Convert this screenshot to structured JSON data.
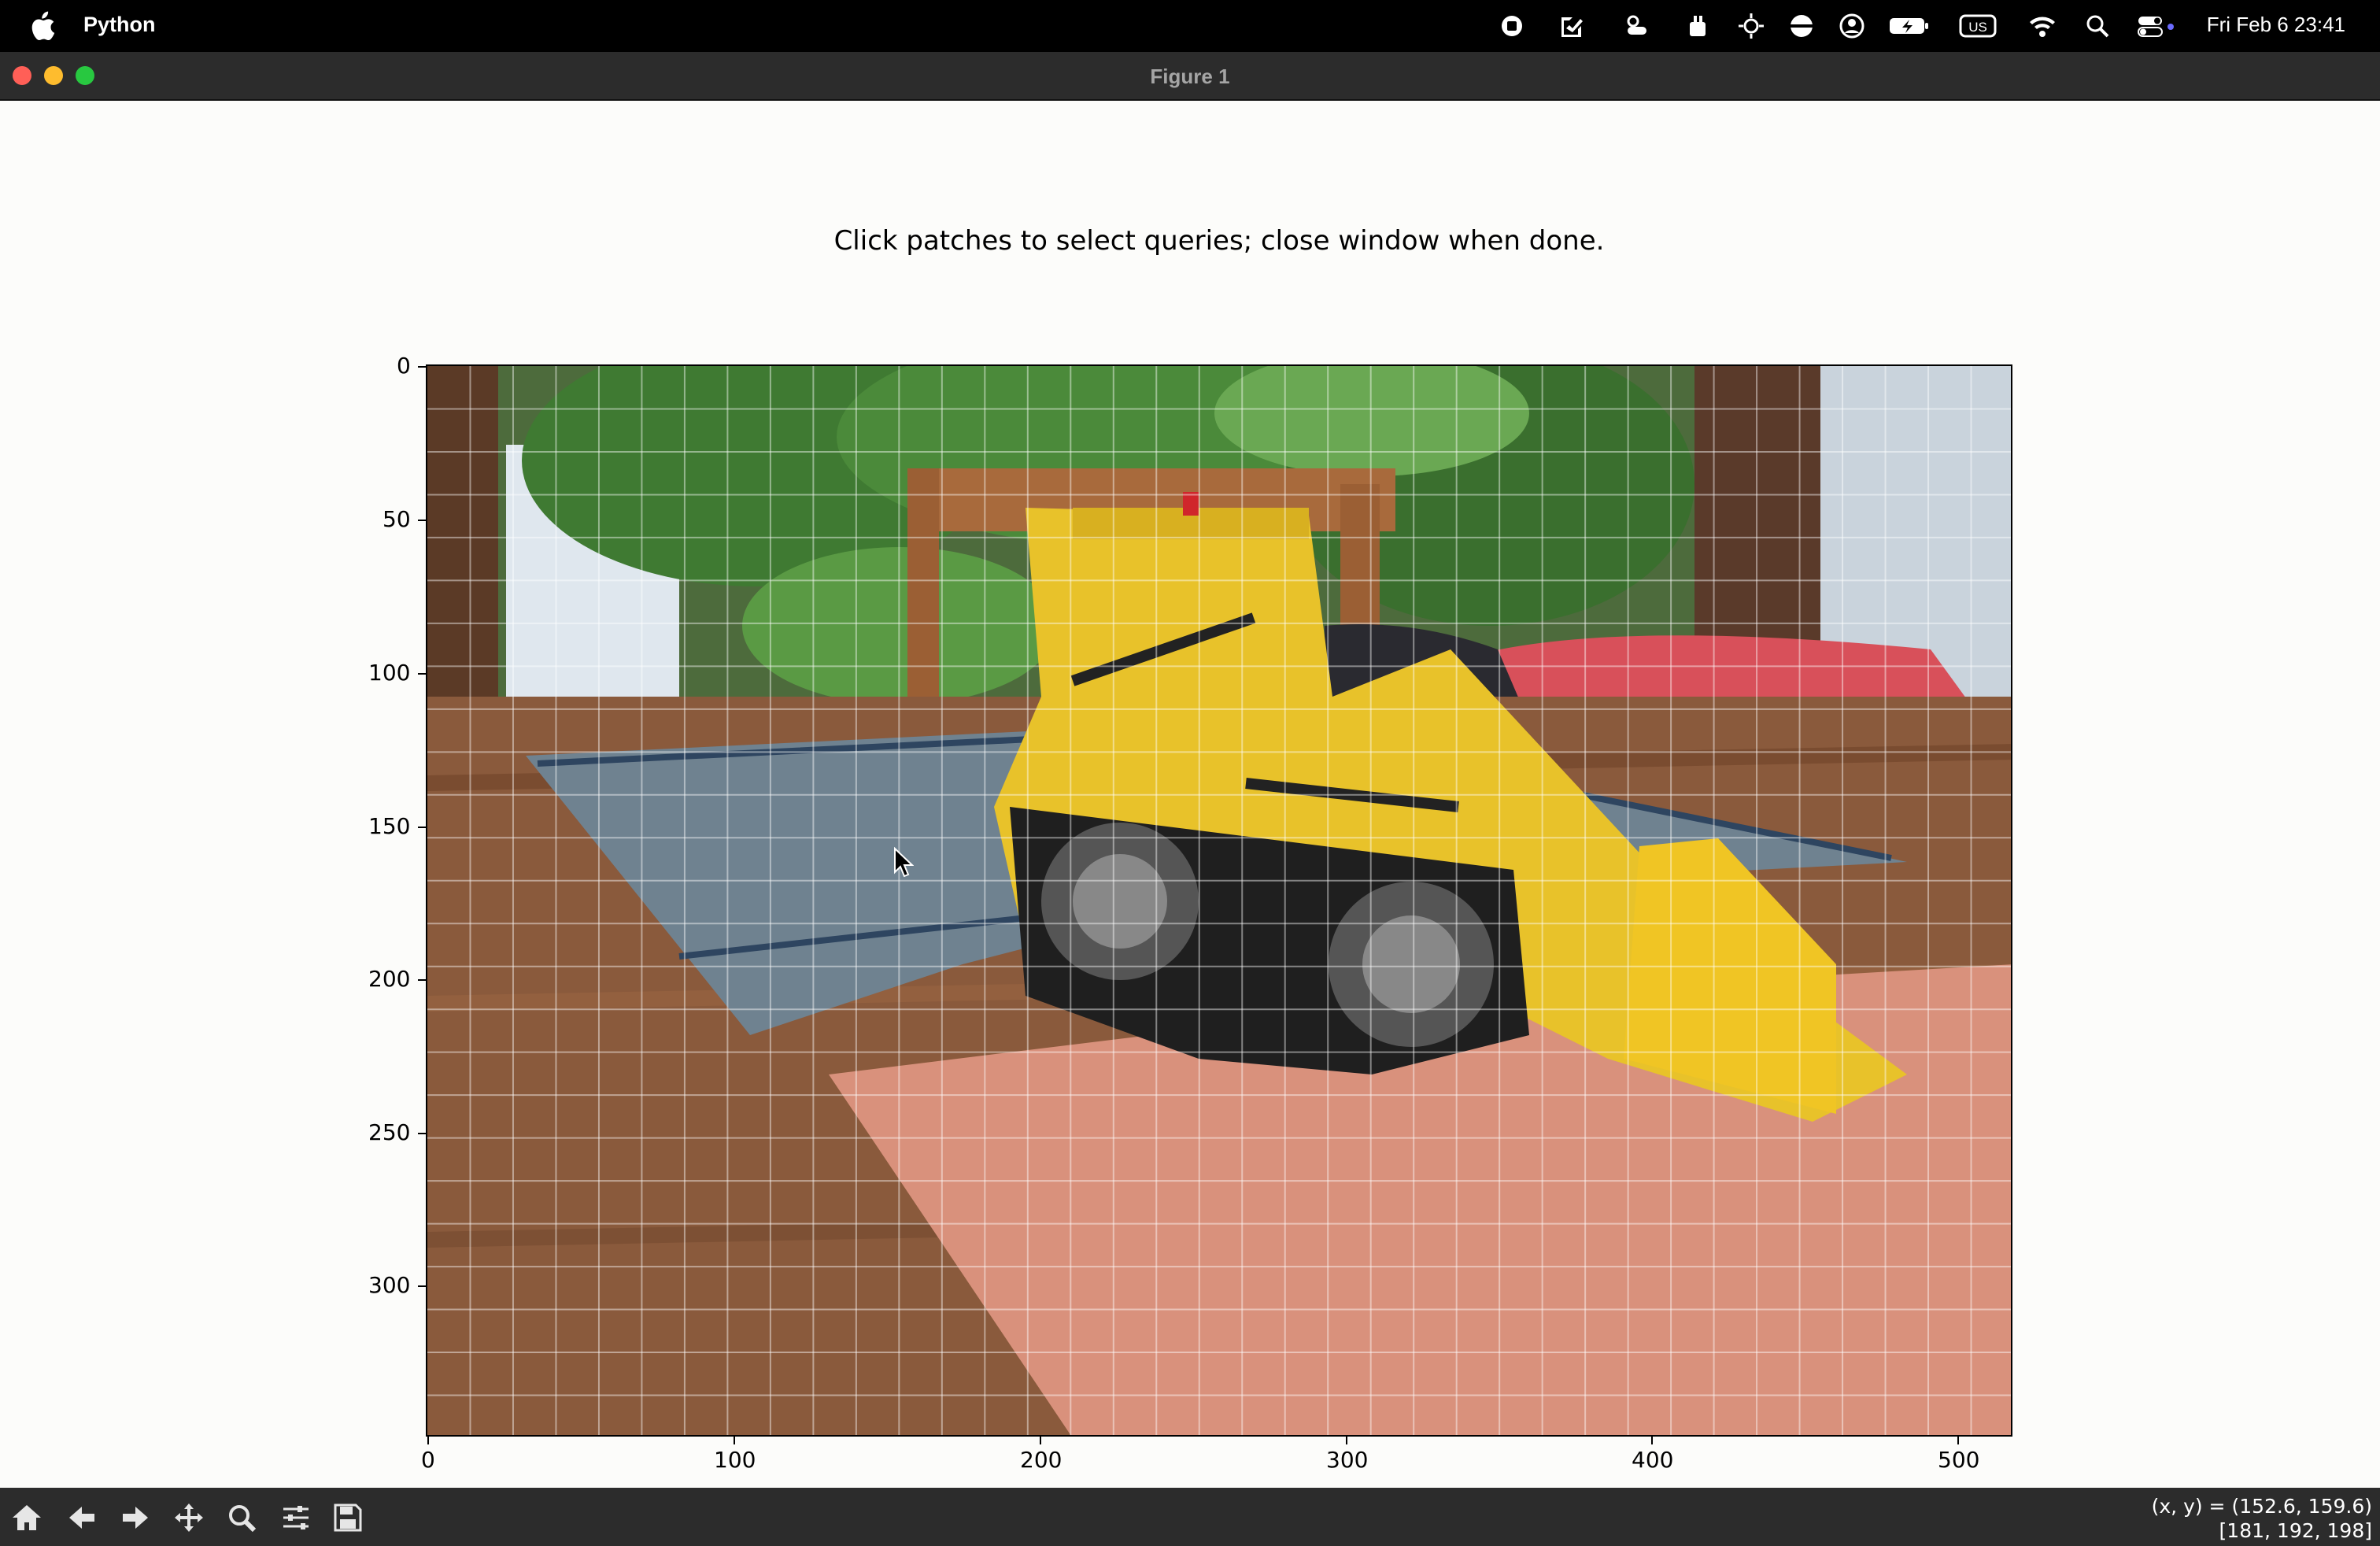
{
  "menubar": {
    "app_name": "Python",
    "clock": "Fri Feb 6  23:41",
    "status_icons": [
      "record-icon",
      "creative-cloud-icon",
      "weather-icon",
      "extension-icon",
      "brightness-icon",
      "display-icon",
      "user-icon",
      "battery-icon",
      "input-source-icon",
      "wifi-icon",
      "search-icon",
      "control-center-icon"
    ],
    "input_source": "US"
  },
  "window": {
    "title": "Figure 1",
    "traffic_colors": {
      "close": "#ff5f57",
      "minimize": "#febc2e",
      "zoom": "#28c840"
    }
  },
  "figure": {
    "axes_title": "Click patches to select queries; close window when done.",
    "image_description_colors": {
      "table": "#8a5a3c",
      "mat_pink": "#d9917c",
      "mat_blue": "#6f8290",
      "lego_yellow": "#e8c22a",
      "plant_green": "#3f7a32"
    },
    "x_ticks": [
      "0",
      "100",
      "200",
      "300",
      "400",
      "500"
    ],
    "y_ticks": [
      "0",
      "50",
      "100",
      "150",
      "200",
      "250",
      "300"
    ],
    "x_range": [
      0,
      518
    ],
    "y_range": [
      350,
      0
    ],
    "patch_grid_size": 14
  },
  "toolbar": {
    "tools": [
      "home-icon",
      "back-icon",
      "forward-icon",
      "pan-icon",
      "zoom-icon",
      "configure-subplots-icon",
      "save-icon"
    ],
    "coords_line1": "(x, y) = (152.6, 159.6)",
    "coords_line2": "[181, 192, 198]"
  }
}
